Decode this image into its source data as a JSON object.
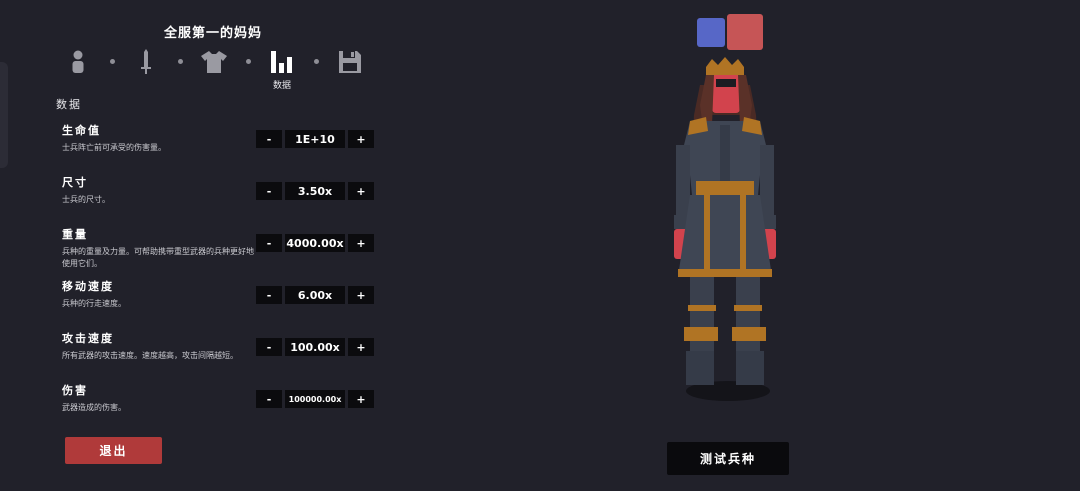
{
  "unit": {
    "name": "全服第一的妈妈"
  },
  "nav": {
    "items": [
      {
        "icon": "person-icon"
      },
      {
        "icon": "sword-icon"
      },
      {
        "icon": "shirt-icon"
      },
      {
        "icon": "stats-icon",
        "label": "数据"
      },
      {
        "icon": "save-icon"
      }
    ]
  },
  "section": {
    "title": "数据"
  },
  "stats": [
    {
      "name": "生命值",
      "desc": "士兵阵亡前可承受的伤害量。",
      "value": "1E+10"
    },
    {
      "name": "尺寸",
      "desc": "士兵的尺寸。",
      "value": "3.50x"
    },
    {
      "name": "重量",
      "desc": "兵种的重量及力量。可帮助携带重型武器的兵种更好地使用它们。",
      "value": "4000.00x"
    },
    {
      "name": "移动速度",
      "desc": "兵种的行走速度。",
      "value": "6.00x"
    },
    {
      "name": "攻击速度",
      "desc": "所有武器的攻击速度。速度越高，攻击间隔越短。",
      "value": "100.00x"
    },
    {
      "name": "伤害",
      "desc": "武器造成的伤害。",
      "value": "100000.00x"
    }
  ],
  "controls": {
    "minus": "-",
    "plus": "+"
  },
  "buttons": {
    "exit": "退出",
    "test": "测试兵种"
  },
  "colors": {
    "team_blue": "#5767c7",
    "team_red": "#c65556",
    "exit": "#b03a3a"
  }
}
